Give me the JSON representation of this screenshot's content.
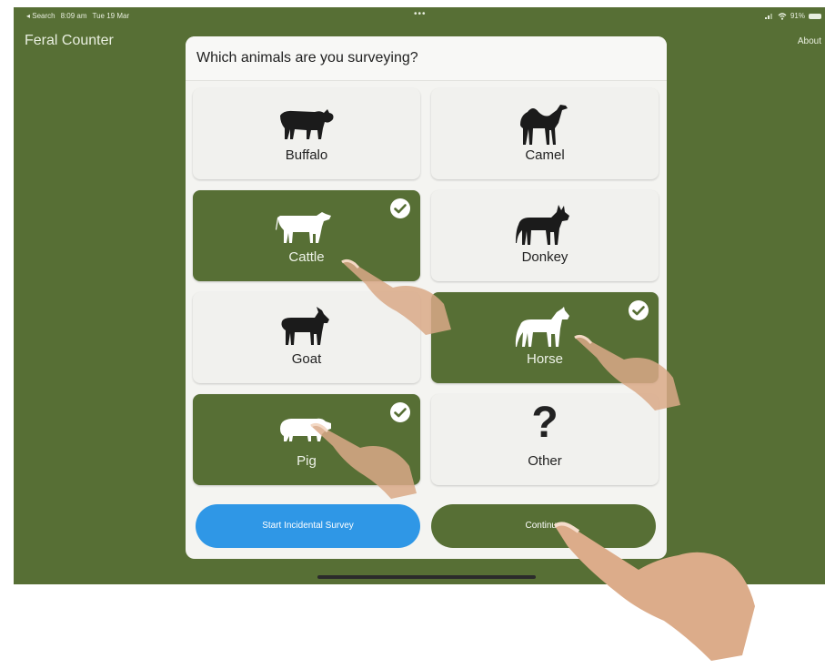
{
  "status_bar": {
    "back_label": "◂ Search",
    "time": "8:09 am",
    "date": "Tue 19 Mar",
    "dots": "•••",
    "battery": "91%"
  },
  "app": {
    "title": "Feral Counter",
    "about_label": "About"
  },
  "dialog": {
    "title": "Which animals are you surveying?",
    "animals": [
      {
        "label": "Buffalo",
        "selected": false,
        "icon": "buffalo-icon"
      },
      {
        "label": "Camel",
        "selected": false,
        "icon": "camel-icon"
      },
      {
        "label": "Cattle",
        "selected": true,
        "icon": "cattle-icon"
      },
      {
        "label": "Donkey",
        "selected": false,
        "icon": "donkey-icon"
      },
      {
        "label": "Goat",
        "selected": false,
        "icon": "goat-icon"
      },
      {
        "label": "Horse",
        "selected": true,
        "icon": "horse-icon"
      },
      {
        "label": "Pig",
        "selected": true,
        "icon": "pig-icon"
      },
      {
        "label": "Other",
        "selected": false,
        "icon": "question-mark-icon",
        "glyph": "?"
      }
    ],
    "start_incidental_label": "Start Incidental Survey",
    "continue_label": "Continue"
  },
  "colors": {
    "background_green": "#576f35",
    "button_blue": "#2f97e6",
    "tile_gray": "#f1f1ee"
  }
}
